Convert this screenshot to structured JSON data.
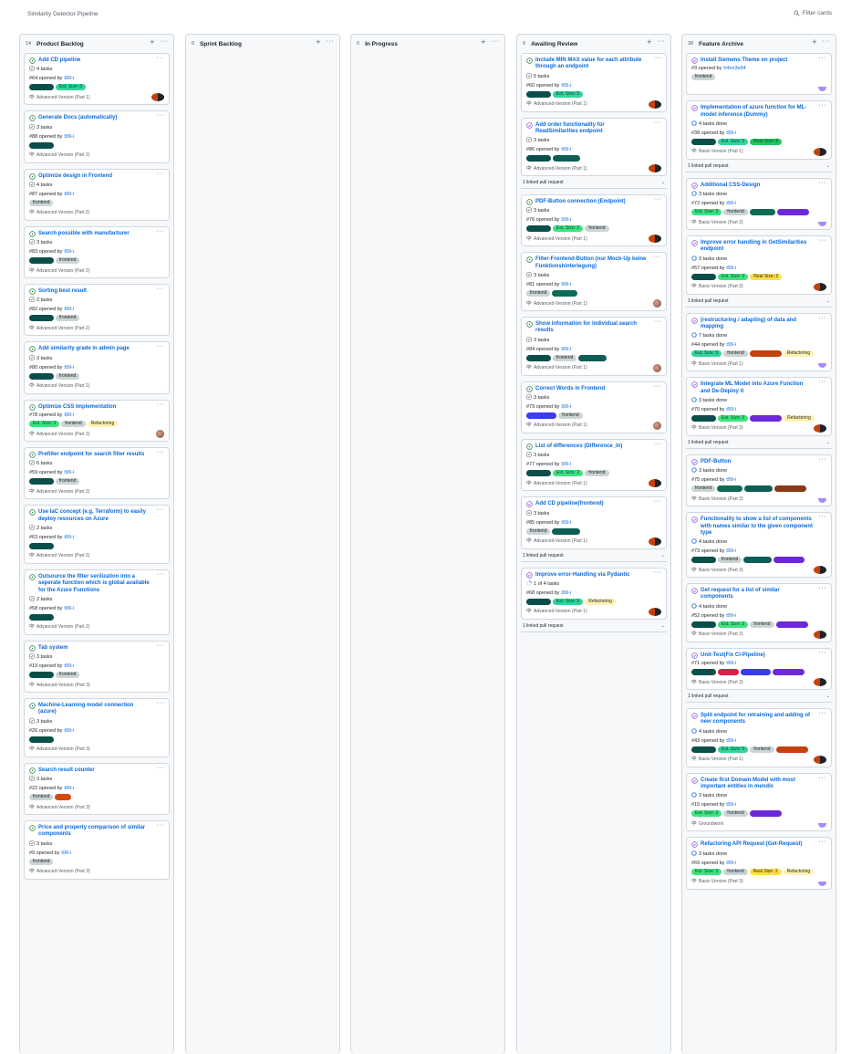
{
  "header": {
    "title": "Similarity Detector Pipeline",
    "filter_placeholder": "Filter cards"
  },
  "label_colors": {
    "backend": [
      "#0b4f4a",
      "#0b4f4a"
    ],
    "Est. Size: 5": [
      "#34d399",
      "#064e3b"
    ],
    "Est. Size: 3": [
      "#3ee37f",
      "#064e3b"
    ],
    "Est. Size: 1": [
      "#3b3bf0",
      "#3b3bf0"
    ],
    "frontend": [
      "#cbd5d5",
      "#1f2328"
    ],
    "Refactoring": [
      "#fdf2b0",
      "#1f2328"
    ],
    "quick task": [
      "#0f5e55",
      "#0f5e55"
    ],
    "Mock-Up": [
      "#0e6b55",
      "#0e6b55"
    ],
    "SFS": [
      "#d9480f",
      "#d9480f"
    ],
    "Real Size: 8": [
      "#22c55e",
      "#064e3b"
    ],
    "Real Size: 5": [
      "#c2410c",
      "#c2410c"
    ],
    "Real Size: 2": [
      "#fde047",
      "#1f2328"
    ],
    "Real Size: 3": [
      "#6d28d9",
      "#6d28d9"
    ],
    "Real Size: 1": [
      "#8b3a1a",
      "#8b3a1a"
    ],
    "bug fix": [
      "#e11d48",
      "#e11d48"
    ]
  },
  "columns": [
    {
      "count": "14",
      "name": "Product Backlog",
      "cards": [
        {
          "title": "Add CD pipeline",
          "tasks": "4 tasks",
          "number": "#64 opened by",
          "author": "t99-i",
          "labels": [
            "backend",
            "Est. Size: 5"
          ],
          "milestone": "Advanced-Version (Part 1)",
          "state": "open",
          "avatar": "pair"
        },
        {
          "title": "Generate Docs (automatically)",
          "tasks": "3 tasks",
          "number": "#88 opened by",
          "author": "t99-i",
          "labels": [
            "backend"
          ],
          "milestone": "Advanced Version (Part 2)",
          "state": "open"
        },
        {
          "title": "Optimize design in Frontend",
          "tasks": "4 tasks",
          "number": "#87 opened by",
          "author": "t99-i",
          "labels": [
            "frontend"
          ],
          "milestone": "Advanced Version (Part 2)",
          "state": "open"
        },
        {
          "title": "Search possible with manufacturer",
          "tasks": "3 tasks",
          "number": "#83 opened by",
          "author": "t99-i",
          "labels": [
            "backend",
            "frontend"
          ],
          "milestone": "Advanced Version (Part 2)",
          "state": "open"
        },
        {
          "title": "Sorting best result",
          "tasks": "2 tasks",
          "number": "#82 opened by",
          "author": "t99-i",
          "labels": [
            "backend",
            "frontend"
          ],
          "milestone": "Advanced Version (Part 2)",
          "state": "open"
        },
        {
          "title": "Add similarity grade in admin page",
          "tasks": "3 tasks",
          "number": "#80 opened by",
          "author": "t99-i",
          "labels": [
            "backend",
            "frontend"
          ],
          "milestone": "Advanced Version (Part 2)",
          "state": "open"
        },
        {
          "title": "Optimize CSS Implementation",
          "number": "#78 opened by",
          "author": "t99-i",
          "labels": [
            "Est. Size: 3",
            "frontend",
            "Refactoring"
          ],
          "milestone": "Advanced Version (Part 2)",
          "state": "open",
          "avatar": "single"
        },
        {
          "title": "Prefilter endpoint for search filter results",
          "tasks": "6 tasks",
          "number": "#59 opened by",
          "author": "t99-i",
          "labels": [
            "backend",
            "frontend"
          ],
          "milestone": "Advanced Version (Part 2)",
          "state": "open"
        },
        {
          "title": "Use IaC concept (e.g. Terraform) to easily deploy resources on Azure",
          "tasks": "2 tasks",
          "number": "#63 opened by",
          "author": "t99-i",
          "labels": [
            "backend"
          ],
          "milestone": "Advanced Version (Part 2)",
          "state": "open"
        },
        {
          "title": "Outsource the filter serilization into a seperate function which is global available for the Azure Functions",
          "tasks": "2 tasks",
          "number": "#58 opened by",
          "author": "t99-i",
          "labels": [
            "backend"
          ],
          "milestone": "Advanced Version (Part 2)",
          "state": "open"
        },
        {
          "title": "Tab system",
          "tasks": "3 tasks",
          "number": "#19 opened by",
          "author": "t99-i",
          "labels": [
            "backend",
            "frontend"
          ],
          "milestone": "Advanced-Version (Part 3)",
          "state": "open"
        },
        {
          "title": "Machine-Learning model connection (azure)",
          "tasks": "3 tasks",
          "number": "#26 opened by",
          "author": "t99-i",
          "labels": [
            "backend"
          ],
          "milestone": "Advanced-Version (Part 3)",
          "state": "open"
        },
        {
          "title": "Search result counter",
          "tasks": "3 tasks",
          "number": "#22 opened by",
          "author": "t99-i",
          "labels": [
            "frontend",
            "SFS"
          ],
          "milestone": "Advanced-Version (Part 3)",
          "state": "open"
        },
        {
          "title": "Price and property comparison of similar components",
          "tasks": "3 tasks",
          "number": "#9 opened by",
          "author": "t99-i",
          "labels": [
            "frontend"
          ],
          "milestone": "Advanced-Version (Part 3)",
          "state": "open"
        }
      ]
    },
    {
      "count": "0",
      "name": "Sprint Backlog",
      "cards": []
    },
    {
      "count": "0",
      "name": "In Progress",
      "cards": []
    },
    {
      "count": "9",
      "name": "Awaiting Review",
      "cards": [
        {
          "title": "Include MIN MAX value for each attribute through an endpoint",
          "tasks": "5 tasks",
          "number": "#60 opened by",
          "author": "t99-i",
          "labels": [
            "backend",
            "Est. Size: 5"
          ],
          "milestone": "Advanced-Version (Part 1)",
          "state": "open",
          "avatar": "pair"
        },
        {
          "title": "Add order functionality for ReadSimilarities endpoint",
          "tasks": "3 tasks",
          "number": "#86 opened by",
          "author": "t99-i",
          "labels": [
            "backend",
            "quick task"
          ],
          "milestone": "Advanced-Version (Part 1)",
          "state": "closed",
          "avatar": "pair",
          "pr": "1 linked pull request"
        },
        {
          "title": "PDF-Button connection (Endpoint)",
          "tasks": "3 tasks",
          "number": "#76 opened by",
          "author": "t99-i",
          "labels": [
            "backend",
            "Est. Size: 3",
            "frontend"
          ],
          "milestone": "Advanced-Version (Part 1)",
          "state": "open",
          "avatar": "pair"
        },
        {
          "title": "Filter-Frontend-Button (nur Mock-Up keine Funktionshinterlegung)",
          "tasks": "3 tasks",
          "number": "#81 opened by",
          "author": "t99-i",
          "labels": [
            "frontend",
            "Mock-Up"
          ],
          "milestone": "Advanced-Version (Part 1)",
          "state": "open",
          "avatar": "single"
        },
        {
          "title": "Show information for individual search results",
          "tasks": "3 tasks",
          "number": "#84 opened by",
          "author": "t99-i",
          "labels": [
            "backend",
            "frontend",
            "quick task"
          ],
          "milestone": "Advanced-Version (Part 1)",
          "state": "open",
          "avatar": "single"
        },
        {
          "title": "Correct Words in Frontend",
          "tasks": "3 tasks",
          "number": "#79 opened by",
          "author": "t99-i",
          "labels": [
            "Est. Size: 1",
            "frontend"
          ],
          "milestone": "Advanced-Version (Part 1)",
          "state": "open",
          "avatar": "single"
        },
        {
          "title": "List of differences (Difference_In)",
          "tasks": "3 tasks",
          "number": "#77 opened by",
          "author": "t99-i",
          "labels": [
            "backend",
            "Est. Size: 3",
            "frontend"
          ],
          "milestone": "Advanced-Version (Part 1)",
          "state": "open",
          "avatar": "pair"
        },
        {
          "title": "Add CD pipeline(frontend)",
          "tasks": "3 tasks",
          "number": "#85 opened by",
          "author": "t99-i",
          "labels": [
            "frontend",
            "quick task"
          ],
          "milestone": "Advanced-Version (Part 1)",
          "state": "closed",
          "avatar": "pair",
          "pr": "1 linked pull request"
        },
        {
          "title": "Improve error-Handling via Pydantic",
          "tasks": "1 of 4 tasks",
          "number": "#68 opened by",
          "author": "t99-i",
          "labels": [
            "backend",
            "Est. Size: 5",
            "Refactoring"
          ],
          "milestone": "Advanced-Version (Part 1)",
          "state": "closed",
          "avatar": "pair",
          "pr": "1 linked pull request"
        }
      ]
    },
    {
      "count": "38",
      "name": "Feature Archive",
      "cards": [
        {
          "title": "Install Siemens Theme on project",
          "number": "#3 opened by",
          "author": "h4nn3s94",
          "labels": [
            "frontend"
          ],
          "state": "closed",
          "avatar": "single"
        },
        {
          "title": "Implementation of azure function for ML-model inference (Dummy)",
          "tasks": "4 tasks done",
          "number": "#38 opened by",
          "author": "t99-i",
          "labels": [
            "backend",
            "Est. Size: 5",
            "Real Size: 8"
          ],
          "milestone": "Basic-Version (Part 1)",
          "state": "closed",
          "avatar": "pair",
          "pr": "1 linked pull request"
        },
        {
          "title": "Additional CSS-Design",
          "tasks": "3 tasks done",
          "number": "#72 opened by",
          "author": "t99-i",
          "labels": [
            "Est. Size: 3",
            "frontend",
            "Mock-Up",
            "Real Size: 3"
          ],
          "milestone": "Basic-Version (Part 3)",
          "state": "closed",
          "avatar": "single"
        },
        {
          "title": "Improve error handling in GetSimilarities endpoint",
          "tasks": "3 tasks done",
          "number": "#57 opened by",
          "author": "t99-i",
          "labels": [
            "backend",
            "Est. Size: 3",
            "Real Size: 2"
          ],
          "milestone": "Basic-Version (Part 3)",
          "state": "closed",
          "avatar": "pair",
          "pr": "1 linked pull request"
        },
        {
          "title": "(restructuring / adapting) of data and mapping",
          "tasks": "7 tasks done",
          "number": "#44 opened by",
          "author": "t99-i",
          "labels": [
            "Est. Size: 5",
            "frontend",
            "Real Size: 5",
            "Refactoring"
          ],
          "milestone": "Basic-Version (Part 1)",
          "state": "closed",
          "avatar": "single"
        },
        {
          "title": "Integrate ML Model into Azure Function and De-Deploy it",
          "tasks": "3 tasks done",
          "number": "#70 opened by",
          "author": "t99-i",
          "labels": [
            "backend",
            "Est. Size: 3",
            "Real Size: 3",
            "Refactoring"
          ],
          "milestone": "Basic-Version (Part 3)",
          "state": "closed",
          "avatar": "pair",
          "pr": "1 linked pull request"
        },
        {
          "title": "PDF-Button",
          "tasks": "3 tasks done",
          "number": "#75 opened by",
          "author": "t99-i",
          "labels": [
            "frontend",
            "Mock-Up",
            "quick task",
            "Real Size: 1"
          ],
          "milestone": "Basic-Version (Part 3)",
          "state": "closed",
          "avatar": "single"
        },
        {
          "title": "Functionality to show a list of components with names similar to the given component type",
          "tasks": "4 tasks done",
          "number": "#73 opened by",
          "author": "t99-i",
          "labels": [
            "backend",
            "frontend",
            "quick task",
            "Real Size: 3"
          ],
          "milestone": "Basic-Version (Part 3)",
          "state": "closed",
          "avatar": "pair"
        },
        {
          "title": "Get request for a list of similar components",
          "tasks": "4 tasks done",
          "number": "#52 opened by",
          "author": "t99-i",
          "labels": [
            "backend",
            "Est. Size: 3",
            "frontend",
            "Real Size: 3"
          ],
          "milestone": "Basic-Version (Part 3)",
          "state": "closed",
          "avatar": "pair"
        },
        {
          "title": "Unit-Test(Fix CI-Pipeline)",
          "number": "#71 opened by",
          "author": "t99-i",
          "labels": [
            "backend",
            "bug fix",
            "Est. Size: 1",
            "Real Size: 3"
          ],
          "milestone": "Basic-Version (Part 3)",
          "state": "closed",
          "avatar": "pair",
          "pr": "1 linked pull request"
        },
        {
          "title": "Split endpoint for retraining and adding of new components",
          "tasks": "4 tasks done",
          "number": "#43 opened by",
          "author": "t99-i",
          "labels": [
            "backend",
            "Est. Size: 5",
            "frontend",
            "Real Size: 5"
          ],
          "milestone": "Basic-Version (Part 1)",
          "state": "closed",
          "avatar": "pair"
        },
        {
          "title": "Create first Domain Model with most important entities in mendix",
          "tasks": "3 tasks done",
          "number": "#15 opened by",
          "author": "t99-i",
          "labels": [
            "Est. Size: 3",
            "frontend",
            "Real Size: 3"
          ],
          "milestone": "Groundwork",
          "state": "closed",
          "avatar": "single"
        },
        {
          "title": "Refactoring API Request (Get-Request)",
          "tasks": "3 tasks done",
          "number": "#69 opened by",
          "author": "t99-i",
          "labels": [
            "Est. Size: 3",
            "frontend",
            "Real Size: 2",
            "Refactoring"
          ],
          "milestone": "Basic-Version (Part 3)",
          "state": "closed",
          "avatar": "single"
        }
      ]
    }
  ]
}
